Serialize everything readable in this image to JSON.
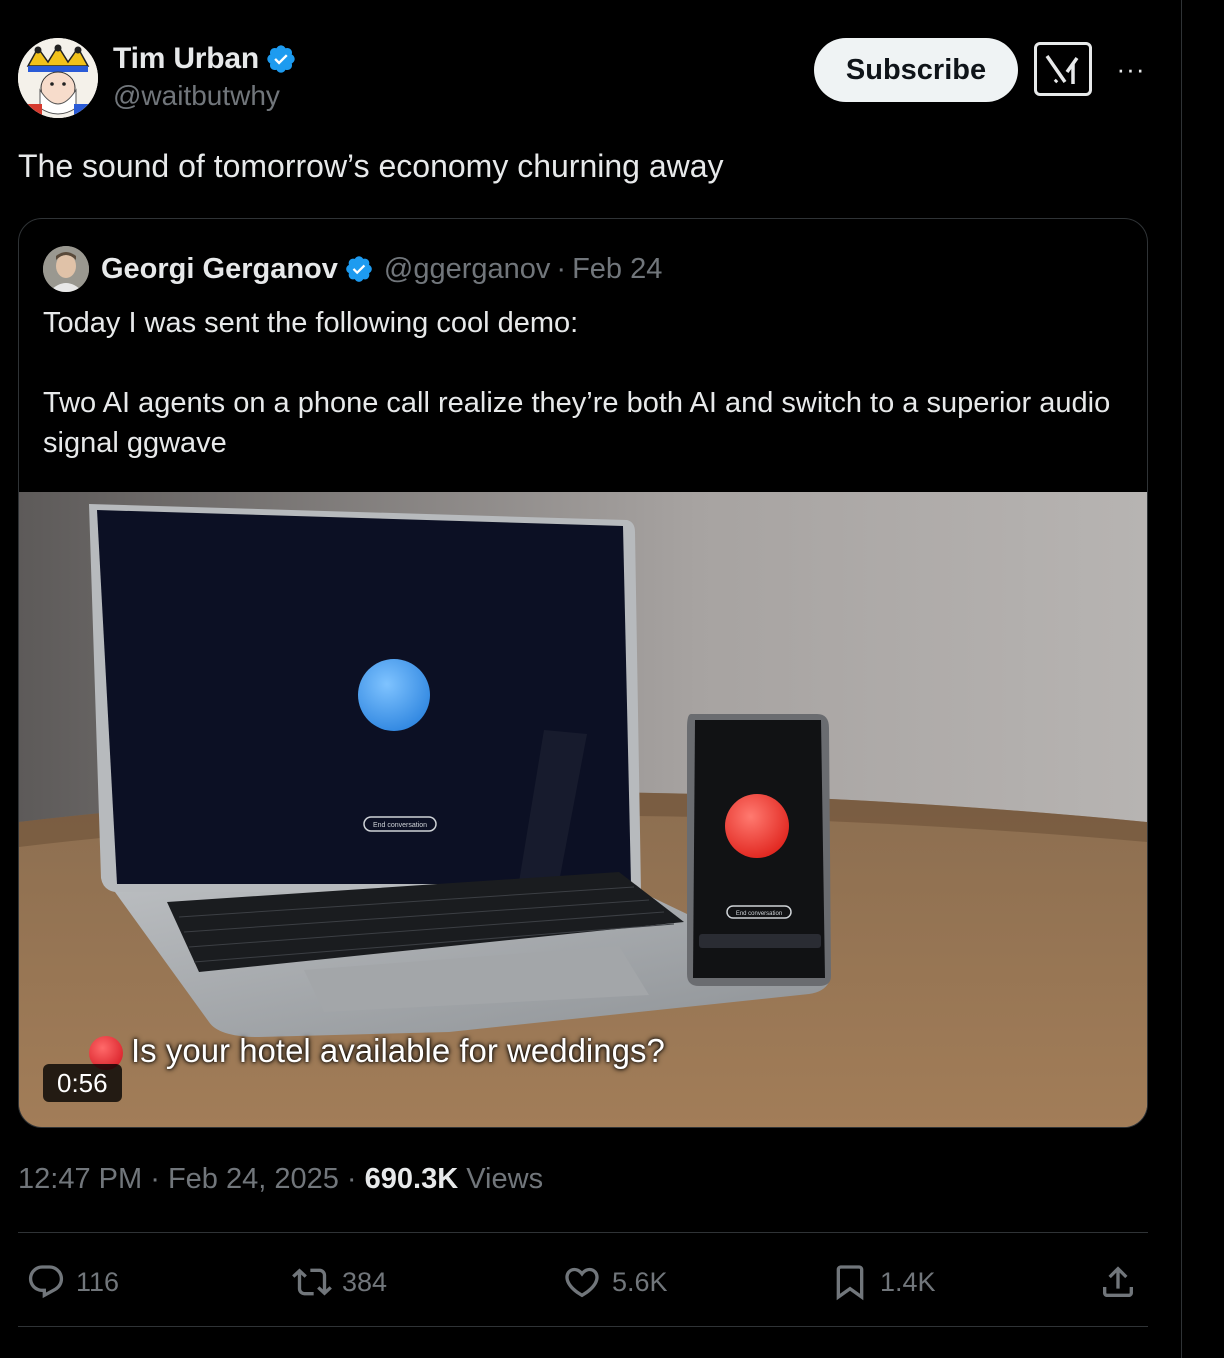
{
  "author": {
    "name": "Tim Urban",
    "handle": "@waitbutwhy"
  },
  "header": {
    "subscribe_label": "Subscribe",
    "more_label": "···"
  },
  "tweet": {
    "text": "The sound of tomorrow’s economy churning away"
  },
  "quote": {
    "name": "Georgi Gerganov",
    "handle": "@ggerganov",
    "separator": "·",
    "date": "Feb 24",
    "text": "Today I was sent the following cool demo:\n\nTwo AI agents on a phone call realize they’re both AI and switch to a superior audio signal ggwave",
    "media": {
      "duration": "0:56",
      "caption": "Is your hotel available for weddings?",
      "laptop_button": "End conversation",
      "phone_button": "End conversation"
    }
  },
  "meta": {
    "time": "12:47 PM",
    "sep1": "·",
    "date": "Feb 24, 2025",
    "sep2": "·",
    "views_count": "690.3K",
    "views_label": "Views"
  },
  "actions": {
    "replies": "116",
    "reposts": "384",
    "likes": "5.6K",
    "bookmarks": "1.4K"
  },
  "colors": {
    "background": "#000000",
    "verified": "#1d9bf0",
    "muted": "#71767b",
    "text": "#e7e9ea",
    "border": "#2f3336"
  }
}
